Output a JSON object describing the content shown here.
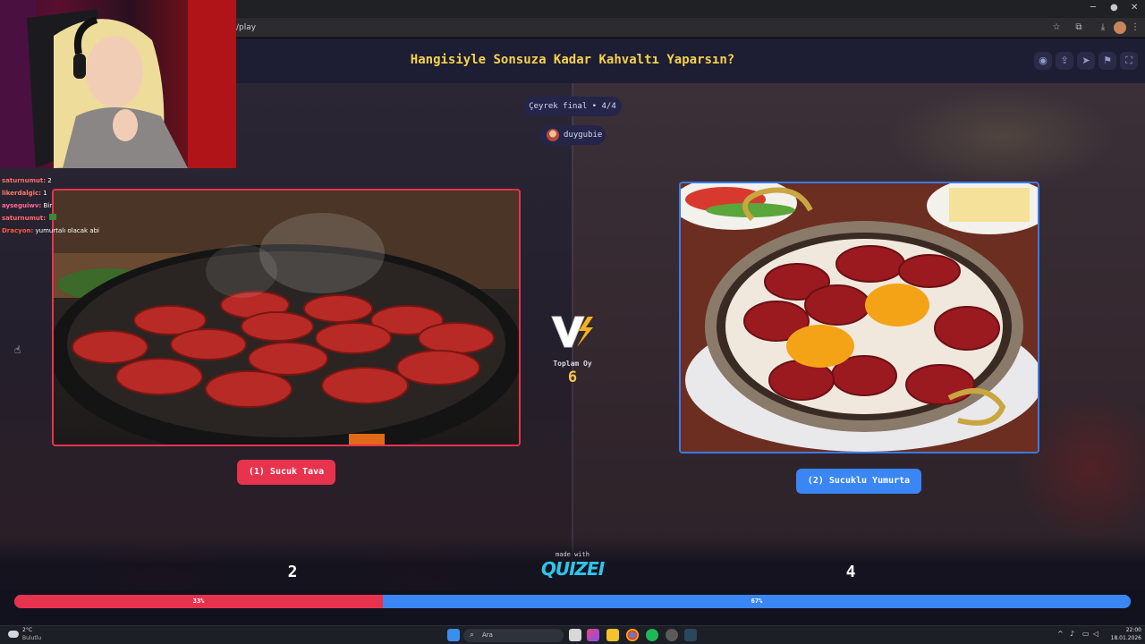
{
  "browser": {
    "url": "/play",
    "window_controls": [
      "─",
      "●",
      "✕"
    ]
  },
  "header": {
    "title": "Hangisiyle Sonsuza Kadar Kahvaltı Yaparsın?"
  },
  "round": {
    "label": "Çeyrek final • 4/4"
  },
  "creator": {
    "name": "duygubie"
  },
  "options": [
    {
      "label": "(1) Sucuk Tava",
      "votes": "2",
      "percent_label": "33%",
      "fraction": 0.33,
      "color": "#e8334e",
      "image": "sucuk-tava-pan"
    },
    {
      "label": "(2) Sucuklu Yumurta",
      "votes": "4",
      "percent_label": "67%",
      "fraction": 0.67,
      "color": "#3a86f5",
      "image": "sucuklu-yumurta-pan"
    }
  ],
  "total": {
    "label": "Toplam Oy",
    "value": "6"
  },
  "footer": {
    "made_with": "made with",
    "brand": "QUIZEI"
  },
  "chat": [
    {
      "user": "saturnumut:",
      "message": "2",
      "color": "#ff6b6b"
    },
    {
      "user": "likerdalgic:",
      "message": "1",
      "color": "#ff7a6a"
    },
    {
      "user": "ayseguiwv:",
      "message": "Bir",
      "color": "#ff6b9a"
    },
    {
      "user": "saturnumut:",
      "message": "",
      "color": "#ff6b6b"
    },
    {
      "user": "Dracyon:",
      "message": "yumurtalı olacak abi",
      "color": "#ff5a3c"
    }
  ],
  "taskbar": {
    "weather_temp": "2°C",
    "weather_desc": "Bulutlu",
    "search_placeholder": "Ara",
    "time": "22:00",
    "date": "18.01.2026"
  }
}
